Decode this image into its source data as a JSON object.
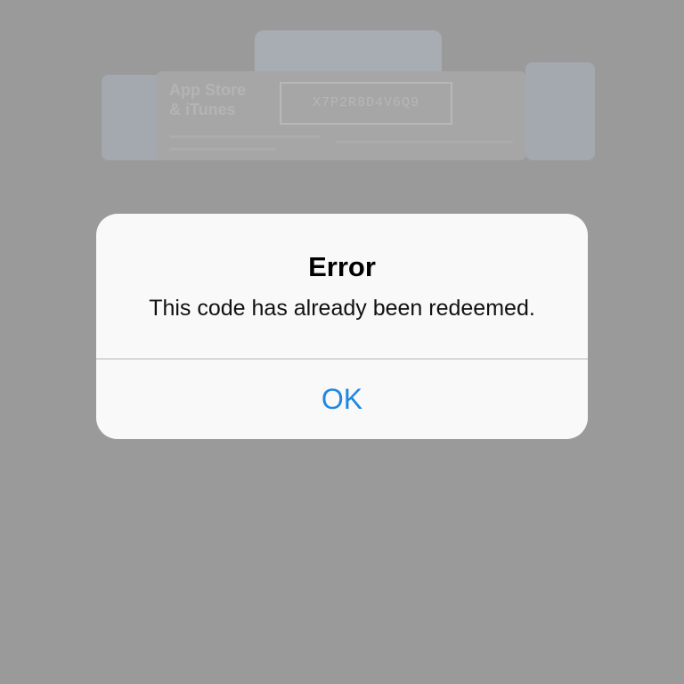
{
  "background": {
    "gift_card_title": "App Store\n& iTunes",
    "gift_card_code": "X7P2R8D4V6Q9"
  },
  "alert": {
    "title": "Error",
    "message": "This code has already been redeemed.",
    "ok_label": "OK"
  },
  "colors": {
    "overlay_gray": "#9a9a9a",
    "alert_background": "#f9f9f9",
    "button_blue": "#1f87e0",
    "divider": "#d9d9dc"
  }
}
